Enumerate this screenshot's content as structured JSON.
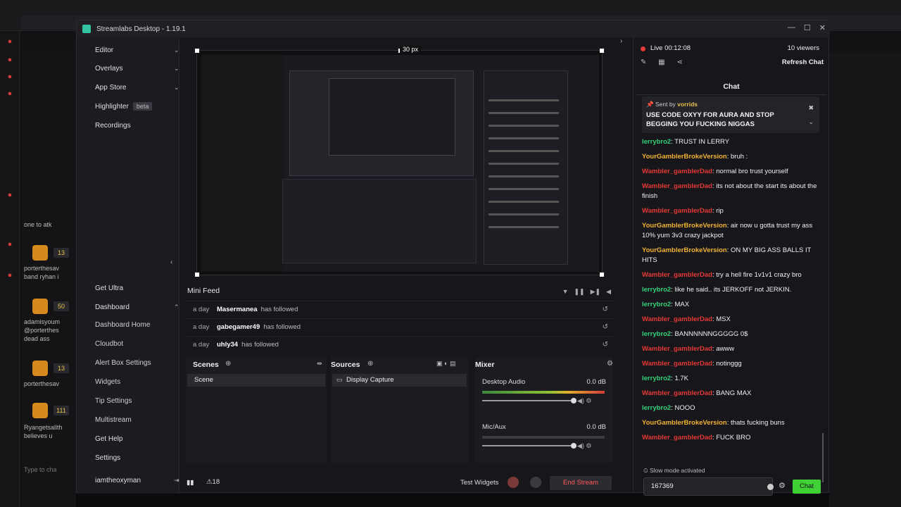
{
  "app": {
    "title": "Streamlabs Desktop - 1.19.1"
  },
  "sidebar": {
    "items": [
      {
        "label": "Editor"
      },
      {
        "label": "Overlays"
      },
      {
        "label": "App Store"
      },
      {
        "label": "Highlighter",
        "badge": "beta"
      },
      {
        "label": "Recordings"
      }
    ],
    "bottom": {
      "get_ultra": "Get Ultra",
      "dashboard": "Dashboard",
      "sub": [
        "Dashboard Home",
        "Cloudbot",
        "Alert Box Settings",
        "Widgets",
        "Tip Settings",
        "Multistream"
      ],
      "get_help": "Get Help",
      "settings": "Settings",
      "user": "iamtheoxyman"
    }
  },
  "preview": {
    "px_label": "30 px"
  },
  "mini_feed": {
    "title": "Mini Feed",
    "rows": [
      {
        "when": "a day",
        "name": "Masermanea",
        "action": "has followed"
      },
      {
        "when": "a day",
        "name": "gabegamer49",
        "action": "has followed"
      },
      {
        "when": "a day",
        "name": "uhly34",
        "action": "has followed"
      }
    ]
  },
  "scenes": {
    "title": "Scenes",
    "items": [
      "Scene"
    ]
  },
  "sources": {
    "title": "Sources",
    "items": [
      "Display Capture"
    ]
  },
  "mixer": {
    "title": "Mixer",
    "channels": [
      {
        "name": "Desktop Audio",
        "db": "0.0 dB",
        "level": 1.0
      },
      {
        "name": "Mic/Aux",
        "db": "0.0 dB",
        "level": 0.0
      }
    ]
  },
  "footer": {
    "count": "18",
    "test_widgets": "Test Widgets",
    "end_stream": "End Stream"
  },
  "chat": {
    "live": "Live 00:12:08",
    "viewers": "10 viewers",
    "refresh": "Refresh Chat",
    "tab": "Chat",
    "pinned": {
      "sent_by_prefix": "Sent by",
      "sent_by": "vorrids",
      "message": "USE CODE OXYY FOR AURA AND STOP BEGGING YOU FUCKING NIGGAS"
    },
    "messages": [
      {
        "user": "lerrybro2",
        "color": "#33d17a",
        "text": "TRUST IN LERRY"
      },
      {
        "user": "YourGamblerBrokeVersion",
        "color": "#f2b233",
        "text": "bruh :"
      },
      {
        "user": "Wambler_gamblerDad",
        "color": "#e53935",
        "text": "normal bro trust yourself"
      },
      {
        "user": "Wambler_gamblerDad",
        "color": "#e53935",
        "text": "its not about the start its about the finish"
      },
      {
        "user": "Wambler_gamblerDad",
        "color": "#e53935",
        "text": "rip"
      },
      {
        "user": "YourGamblerBrokeVersion",
        "color": "#f2b233",
        "text": "air now u gotta trust my ass 10% yum 3v3 crazy jackpot"
      },
      {
        "user": "YourGamblerBrokeVersion",
        "color": "#f2b233",
        "text": "ON MY BIG ASS BALLS IT HITS"
      },
      {
        "user": "Wambler_gamblerDad",
        "color": "#e53935",
        "text": "try a hell fire 1v1v1 crazy bro"
      },
      {
        "user": "lerrybro2",
        "color": "#33d17a",
        "text": "like he said.. its JERKOFF not JERKIN."
      },
      {
        "user": "lerrybro2",
        "color": "#33d17a",
        "text": "MAX"
      },
      {
        "user": "Wambler_gamblerDad",
        "color": "#e53935",
        "text": "MSX"
      },
      {
        "user": "lerrybro2",
        "color": "#33d17a",
        "text": "BANNNNNNGGGGG 0$"
      },
      {
        "user": "Wambler_gamblerDad",
        "color": "#e53935",
        "text": "awww"
      },
      {
        "user": "Wambler_gamblerDad",
        "color": "#e53935",
        "text": "notinggg"
      },
      {
        "user": "lerrybro2",
        "color": "#33d17a",
        "text": "1.7K"
      },
      {
        "user": "Wambler_gamblerDad",
        "color": "#e53935",
        "text": "BANG MAX"
      },
      {
        "user": "lerrybro2",
        "color": "#33d17a",
        "text": "NOOO"
      },
      {
        "user": "YourGamblerBrokeVersion",
        "color": "#f2b233",
        "text": "thats fucking buns"
      },
      {
        "user": "Wambler_gamblerDad",
        "color": "#e53935",
        "text": "FUCK BRO"
      }
    ],
    "slow_mode": "Slow mode activated",
    "input_value": "167369",
    "send_label": "Chat"
  },
  "kick_panel": {
    "labels": [
      "one to atk",
      "porterthesav",
      "band ryhan i",
      "adamisyoum",
      "@porterthes",
      "dead ass",
      "porterthesav",
      "Ryangetsallth",
      "believes u",
      "Type to cha"
    ],
    "counts": [
      "13",
      "50",
      "13",
      "111"
    ]
  }
}
